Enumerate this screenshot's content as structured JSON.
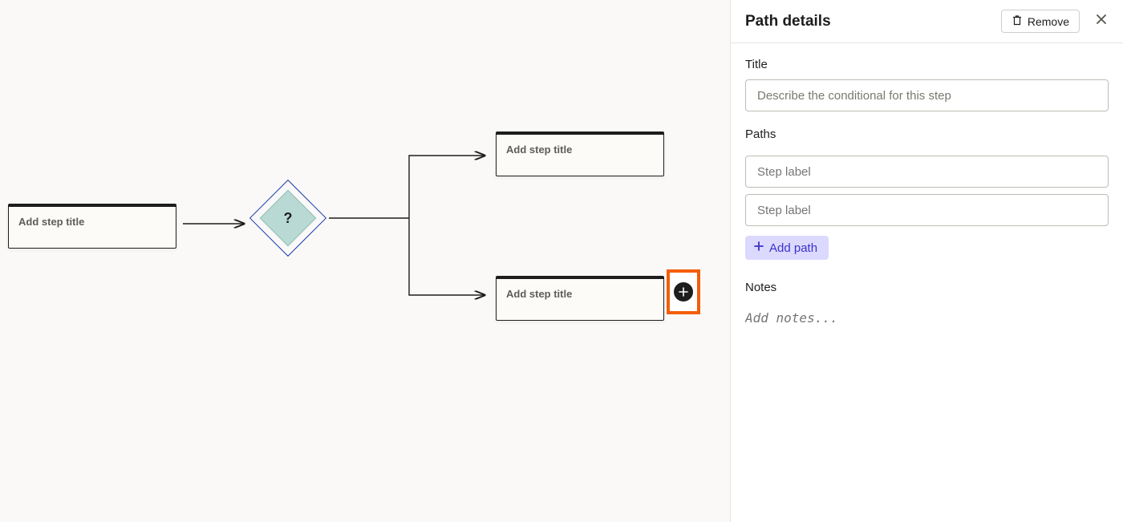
{
  "canvas": {
    "left_step": {
      "placeholder": "Add step title"
    },
    "decision": {
      "symbol": "?"
    },
    "top_step": {
      "placeholder": "Add step title"
    },
    "bottom_step": {
      "placeholder": "Add step title"
    }
  },
  "panel": {
    "header": {
      "title": "Path details",
      "remove_label": "Remove"
    },
    "title_field": {
      "label": "Title",
      "placeholder": "Describe the conditional for this step",
      "value": ""
    },
    "paths_field": {
      "label": "Paths",
      "items": [
        {
          "placeholder": "Step label",
          "value": ""
        },
        {
          "placeholder": "Step label",
          "value": ""
        }
      ],
      "add_button_label": "Add path"
    },
    "notes_field": {
      "label": "Notes",
      "placeholder": "Add notes...",
      "value": ""
    }
  },
  "colors": {
    "highlight_orange": "#f45d0a",
    "diamond_fill": "#b9d9d4",
    "accent_purple_bg": "#dcd9ff",
    "accent_purple_fg": "#3c32c8"
  }
}
